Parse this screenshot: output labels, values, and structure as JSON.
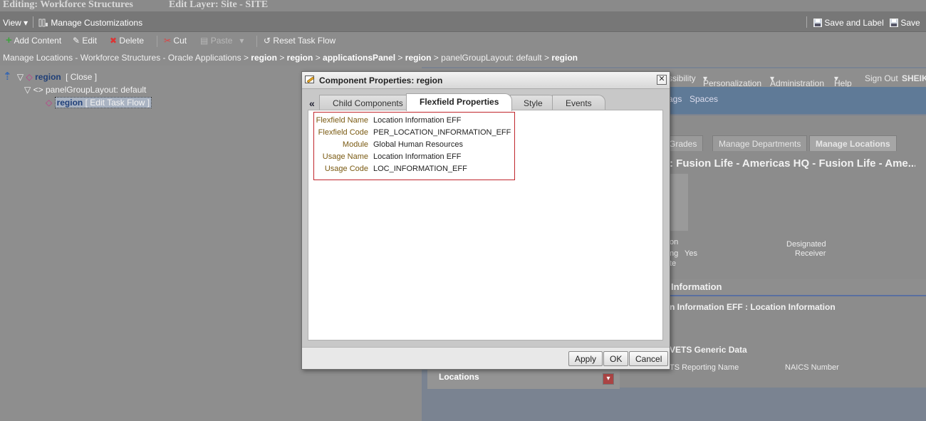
{
  "composer": {
    "title": "Editing: Workforce Structures",
    "edit_layer": "Edit Layer: Site - SITE",
    "menu": {
      "view": "View",
      "manage_customizations": "Manage Customizations",
      "save_and_label": "Save and Label",
      "save": "Save"
    },
    "toolbar": {
      "add_content": "Add Content",
      "edit": "Edit",
      "delete": "Delete",
      "cut": "Cut",
      "paste": "Paste",
      "reset_task_flow": "Reset Task Flow"
    },
    "breadcrumb": {
      "root": "Manage Locations - Workforce Structures - Oracle Applications",
      "sep": ">",
      "items": [
        "region",
        "region",
        "applicationsPanel",
        "region"
      ],
      "panel": "panelGroupLayout: default",
      "current": "region"
    }
  },
  "tree": {
    "root_label": "region",
    "root_action": "[ Close ]",
    "child_label": "panelGroupLayout: default",
    "leaf_label": "region",
    "leaf_action_open": "[",
    "leaf_action": "Edit Task Flow",
    "leaf_action_close": "]"
  },
  "background_app": {
    "nav": [
      "ssibility",
      "Personalization",
      "Administration",
      "Help",
      "Sign Out",
      "SHEIK"
    ],
    "band": [
      "ags",
      "Spaces"
    ],
    "tabs": [
      "Grades",
      "Manage Departments",
      "Manage Locations"
    ],
    "location_title": ": Fusion Life - Americas HQ - Fusion Life - Ame...",
    "field_on": "on",
    "field_ng": "ng",
    "field_yes": "Yes",
    "field_te": "te",
    "designated": "Designated",
    "receiver": "Receiver",
    "information": "Information",
    "eff_section": "n Information EFF : Location Information",
    "vets": "VETS Generic Data",
    "ts_reporting": "TS Reporting Name",
    "naics": "NAICS Number",
    "locations": "Locations"
  },
  "dialog": {
    "title": "Component Properties: region",
    "close_glyph": "✕",
    "collapse_glyph": "«",
    "tabs": [
      {
        "label": "Child Components",
        "active": false
      },
      {
        "label": "Flexfield Properties",
        "active": true
      },
      {
        "label": "Style",
        "active": false
      },
      {
        "label": "Events",
        "active": false
      }
    ],
    "properties": [
      {
        "label": "Flexfield Name",
        "value": "Location Information EFF"
      },
      {
        "label": "Flexfield Code",
        "value": "PER_LOCATION_INFORMATION_EFF"
      },
      {
        "label": "Module",
        "value": "Global Human Resources"
      },
      {
        "label": "Usage Name",
        "value": "Location Information EFF"
      },
      {
        "label": "Usage Code",
        "value": "LOC_INFORMATION_EFF"
      }
    ],
    "buttons": {
      "apply": "Apply",
      "ok": "OK",
      "cancel": "Cancel"
    }
  },
  "colors": {
    "highlight_border": "#c0262c",
    "label_text": "#7a5a12",
    "tree_link": "#1f3f78",
    "active_tab": "#ffffff"
  }
}
